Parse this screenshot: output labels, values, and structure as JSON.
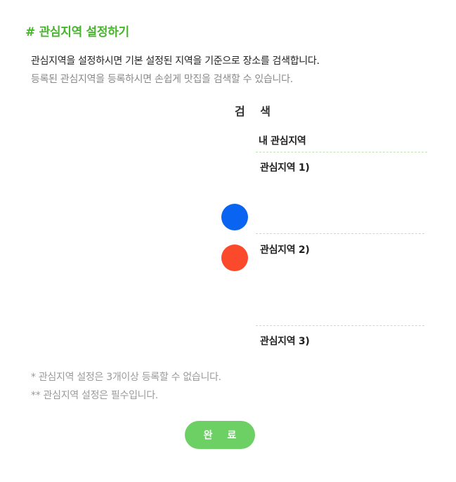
{
  "title": "# 관심지역 설정하기",
  "description": {
    "line1": "관심지역을 설정하시면 기본 설정된 지역을 기준으로 장소를 검색합니다.",
    "line2": "등록된 관심지역을 등록하시면 손쉽게 맛집을 검색할 수 있습니다."
  },
  "search": {
    "label": "검 색"
  },
  "my_regions": {
    "header": "내 관심지역",
    "slots": [
      {
        "label": "관심지역 1)"
      },
      {
        "label": "관심지역 2)"
      },
      {
        "label": "관심지역 3)"
      }
    ]
  },
  "markers": [
    {
      "name": "blue",
      "color": "#0a64f2"
    },
    {
      "name": "red",
      "color": "#fb4a2b"
    }
  ],
  "notes": {
    "note1": "* 관심지역 설정은 3개이상 등록할 수 없습니다.",
    "note2": "** 관심지역 설정은 필수입니다."
  },
  "actions": {
    "done_label": "완 료"
  },
  "colors": {
    "accent": "#47b52c",
    "button": "#6cd064"
  }
}
